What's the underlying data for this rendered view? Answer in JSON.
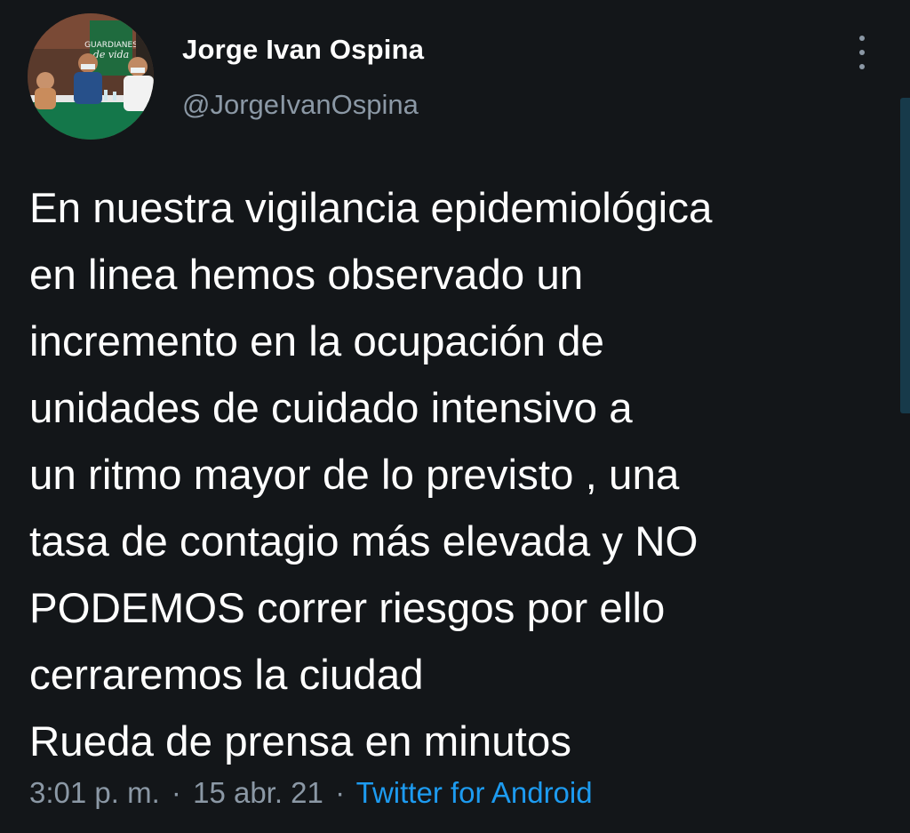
{
  "author": {
    "name": "Jorge Ivan Ospina",
    "handle": "@JorgeIvanOspina",
    "avatar_banner_text": "GUARDIANES de vida"
  },
  "tweet": {
    "lines": [
      "En nuestra vigilancia epidemiológica",
      "en linea hemos observado un",
      "incremento en la ocupación de",
      "unidades de cuidado intensivo a",
      "un ritmo mayor de lo previsto , una",
      "tasa de contagio más elevada y NO",
      "PODEMOS correr riesgos por ello",
      "cerraremos la ciudad",
      "Rueda de prensa en minutos"
    ],
    "time": "3:01 p. m.",
    "separator": "·",
    "date": "15 abr. 21",
    "source": "Twitter for Android"
  },
  "icons": {
    "more": "more-vertical-icon"
  },
  "colors": {
    "background": "#131619",
    "text": "#ffffff",
    "muted": "#8b98a5",
    "link": "#1d9bf0"
  }
}
